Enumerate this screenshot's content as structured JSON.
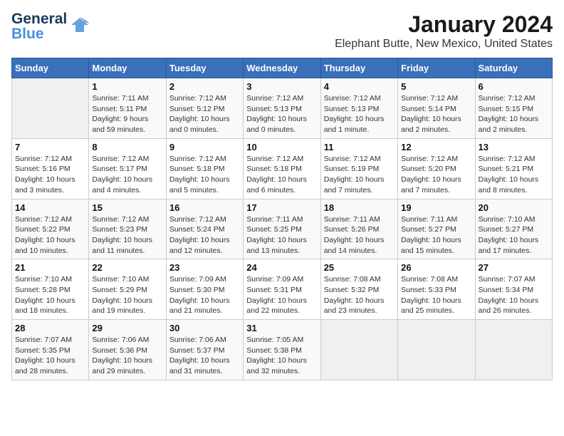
{
  "logo": {
    "line1": "General",
    "line2": "Blue"
  },
  "title": "January 2024",
  "subtitle": "Elephant Butte, New Mexico, United States",
  "days_of_week": [
    "Sunday",
    "Monday",
    "Tuesday",
    "Wednesday",
    "Thursday",
    "Friday",
    "Saturday"
  ],
  "weeks": [
    [
      {
        "num": "",
        "info": ""
      },
      {
        "num": "1",
        "info": "Sunrise: 7:11 AM\nSunset: 5:11 PM\nDaylight: 9 hours\nand 59 minutes."
      },
      {
        "num": "2",
        "info": "Sunrise: 7:12 AM\nSunset: 5:12 PM\nDaylight: 10 hours\nand 0 minutes."
      },
      {
        "num": "3",
        "info": "Sunrise: 7:12 AM\nSunset: 5:13 PM\nDaylight: 10 hours\nand 0 minutes."
      },
      {
        "num": "4",
        "info": "Sunrise: 7:12 AM\nSunset: 5:13 PM\nDaylight: 10 hours\nand 1 minute."
      },
      {
        "num": "5",
        "info": "Sunrise: 7:12 AM\nSunset: 5:14 PM\nDaylight: 10 hours\nand 2 minutes."
      },
      {
        "num": "6",
        "info": "Sunrise: 7:12 AM\nSunset: 5:15 PM\nDaylight: 10 hours\nand 2 minutes."
      }
    ],
    [
      {
        "num": "7",
        "info": "Sunrise: 7:12 AM\nSunset: 5:16 PM\nDaylight: 10 hours\nand 3 minutes."
      },
      {
        "num": "8",
        "info": "Sunrise: 7:12 AM\nSunset: 5:17 PM\nDaylight: 10 hours\nand 4 minutes."
      },
      {
        "num": "9",
        "info": "Sunrise: 7:12 AM\nSunset: 5:18 PM\nDaylight: 10 hours\nand 5 minutes."
      },
      {
        "num": "10",
        "info": "Sunrise: 7:12 AM\nSunset: 5:18 PM\nDaylight: 10 hours\nand 6 minutes."
      },
      {
        "num": "11",
        "info": "Sunrise: 7:12 AM\nSunset: 5:19 PM\nDaylight: 10 hours\nand 7 minutes."
      },
      {
        "num": "12",
        "info": "Sunrise: 7:12 AM\nSunset: 5:20 PM\nDaylight: 10 hours\nand 7 minutes."
      },
      {
        "num": "13",
        "info": "Sunrise: 7:12 AM\nSunset: 5:21 PM\nDaylight: 10 hours\nand 8 minutes."
      }
    ],
    [
      {
        "num": "14",
        "info": "Sunrise: 7:12 AM\nSunset: 5:22 PM\nDaylight: 10 hours\nand 10 minutes."
      },
      {
        "num": "15",
        "info": "Sunrise: 7:12 AM\nSunset: 5:23 PM\nDaylight: 10 hours\nand 11 minutes."
      },
      {
        "num": "16",
        "info": "Sunrise: 7:12 AM\nSunset: 5:24 PM\nDaylight: 10 hours\nand 12 minutes."
      },
      {
        "num": "17",
        "info": "Sunrise: 7:11 AM\nSunset: 5:25 PM\nDaylight: 10 hours\nand 13 minutes."
      },
      {
        "num": "18",
        "info": "Sunrise: 7:11 AM\nSunset: 5:26 PM\nDaylight: 10 hours\nand 14 minutes."
      },
      {
        "num": "19",
        "info": "Sunrise: 7:11 AM\nSunset: 5:27 PM\nDaylight: 10 hours\nand 15 minutes."
      },
      {
        "num": "20",
        "info": "Sunrise: 7:10 AM\nSunset: 5:27 PM\nDaylight: 10 hours\nand 17 minutes."
      }
    ],
    [
      {
        "num": "21",
        "info": "Sunrise: 7:10 AM\nSunset: 5:28 PM\nDaylight: 10 hours\nand 18 minutes."
      },
      {
        "num": "22",
        "info": "Sunrise: 7:10 AM\nSunset: 5:29 PM\nDaylight: 10 hours\nand 19 minutes."
      },
      {
        "num": "23",
        "info": "Sunrise: 7:09 AM\nSunset: 5:30 PM\nDaylight: 10 hours\nand 21 minutes."
      },
      {
        "num": "24",
        "info": "Sunrise: 7:09 AM\nSunset: 5:31 PM\nDaylight: 10 hours\nand 22 minutes."
      },
      {
        "num": "25",
        "info": "Sunrise: 7:08 AM\nSunset: 5:32 PM\nDaylight: 10 hours\nand 23 minutes."
      },
      {
        "num": "26",
        "info": "Sunrise: 7:08 AM\nSunset: 5:33 PM\nDaylight: 10 hours\nand 25 minutes."
      },
      {
        "num": "27",
        "info": "Sunrise: 7:07 AM\nSunset: 5:34 PM\nDaylight: 10 hours\nand 26 minutes."
      }
    ],
    [
      {
        "num": "28",
        "info": "Sunrise: 7:07 AM\nSunset: 5:35 PM\nDaylight: 10 hours\nand 28 minutes."
      },
      {
        "num": "29",
        "info": "Sunrise: 7:06 AM\nSunset: 5:36 PM\nDaylight: 10 hours\nand 29 minutes."
      },
      {
        "num": "30",
        "info": "Sunrise: 7:06 AM\nSunset: 5:37 PM\nDaylight: 10 hours\nand 31 minutes."
      },
      {
        "num": "31",
        "info": "Sunrise: 7:05 AM\nSunset: 5:38 PM\nDaylight: 10 hours\nand 32 minutes."
      },
      {
        "num": "",
        "info": ""
      },
      {
        "num": "",
        "info": ""
      },
      {
        "num": "",
        "info": ""
      }
    ]
  ]
}
